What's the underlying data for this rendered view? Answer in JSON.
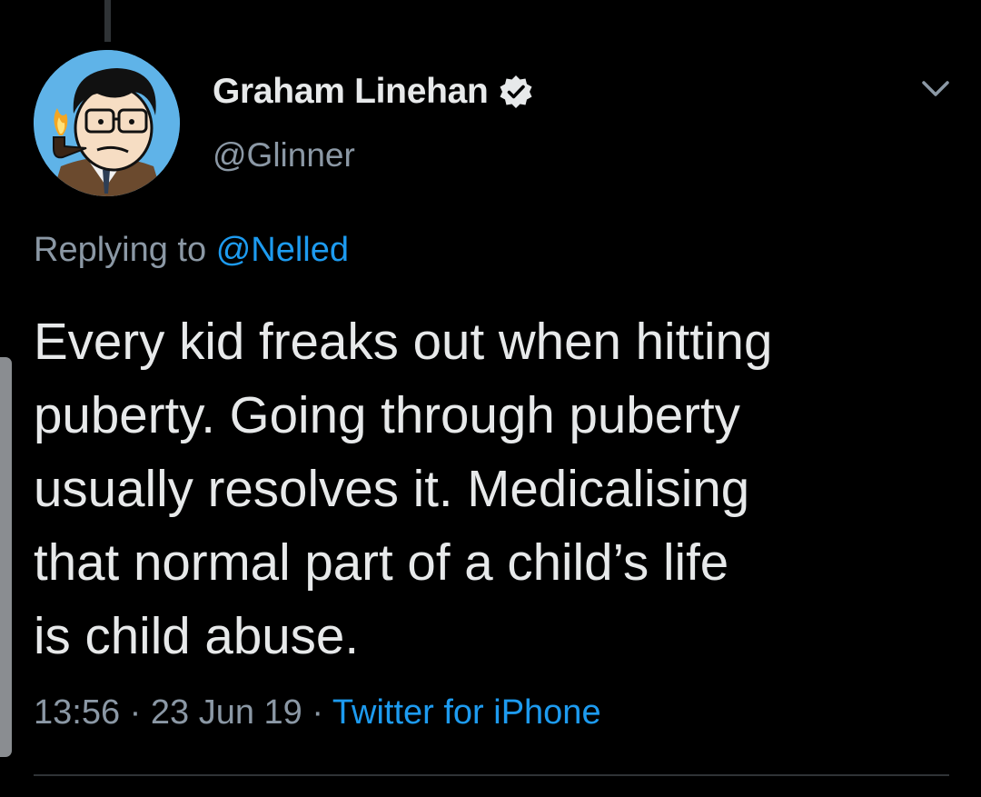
{
  "tweet": {
    "author": {
      "display_name": "Graham Linehan",
      "handle": "@Glinner",
      "verified": true,
      "avatar": "cartoon-portrait-avatar"
    },
    "reply": {
      "prefix": "Replying to",
      "to": "@Nelled"
    },
    "text": "Every kid freaks out when hitting\npuberty. Going through puberty\nusually resolves it. Medicalising\nthat normal part of a child’s life\nis child abuse.",
    "time": "13:56",
    "separator": "·",
    "date": "23 Jun 19",
    "source": "Twitter for iPhone"
  },
  "icons": {
    "verified": "verified-badge-icon",
    "menu": "chevron-down-icon"
  },
  "colors": {
    "background": "#000000",
    "primary_text": "#e7e9ea",
    "secondary_text": "#8b98a5",
    "link": "#1d9bf0",
    "divider": "#2f3336"
  }
}
